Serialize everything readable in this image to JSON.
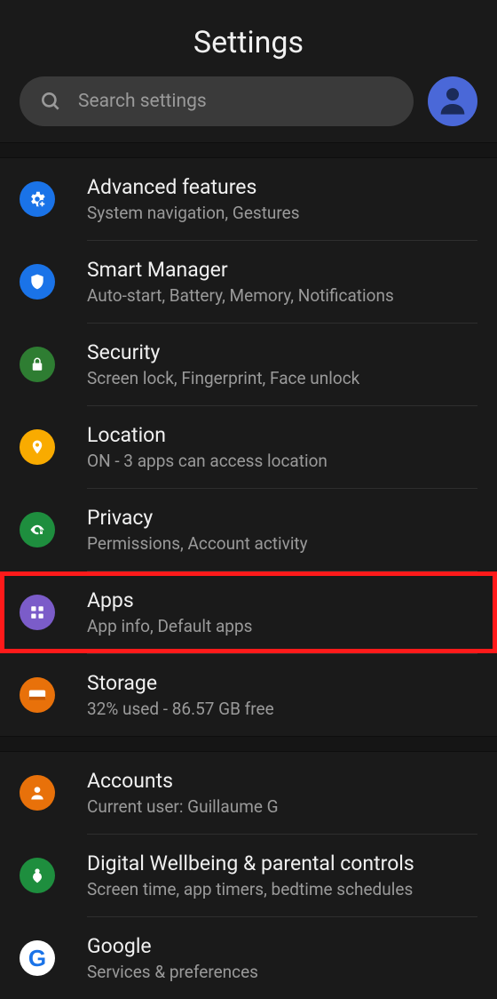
{
  "header": {
    "title": "Settings"
  },
  "search": {
    "placeholder": "Search settings"
  },
  "rows": {
    "advanced": {
      "title": "Advanced features",
      "sub": "System navigation, Gestures"
    },
    "smart": {
      "title": "Smart Manager",
      "sub": "Auto-start, Battery, Memory, Notifications"
    },
    "security": {
      "title": "Security",
      "sub": "Screen lock, Fingerprint, Face unlock"
    },
    "location": {
      "title": "Location",
      "sub": "ON - 3 apps can access location"
    },
    "privacy": {
      "title": "Privacy",
      "sub": "Permissions, Account activity"
    },
    "apps": {
      "title": "Apps",
      "sub": "App info, Default apps"
    },
    "storage": {
      "title": "Storage",
      "sub": "32% used - 86.57 GB free"
    },
    "accounts": {
      "title": "Accounts",
      "sub": "Current user: Guillaume G"
    },
    "wellbeing": {
      "title": "Digital Wellbeing & parental controls",
      "sub": "Screen time, app timers, bedtime schedules"
    },
    "google": {
      "title": "Google",
      "sub": "Services & preferences"
    }
  }
}
